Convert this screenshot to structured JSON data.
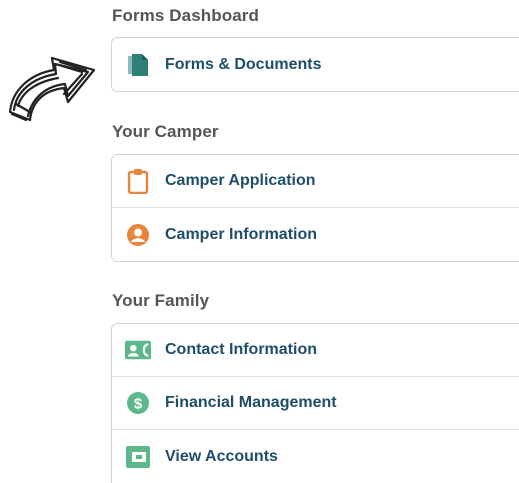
{
  "sections": [
    {
      "title": "Forms Dashboard",
      "items": [
        {
          "label": "Forms & Documents",
          "icon": "document-icon"
        }
      ]
    },
    {
      "title": "Your Camper",
      "items": [
        {
          "label": "Camper Application",
          "icon": "clipboard-icon"
        },
        {
          "label": "Camper Information",
          "icon": "user-circle-icon"
        }
      ]
    },
    {
      "title": "Your Family",
      "items": [
        {
          "label": "Contact Information",
          "icon": "contact-card-icon"
        },
        {
          "label": "Financial Management",
          "icon": "dollar-circle-icon"
        },
        {
          "label": "View Accounts",
          "icon": "wallet-icon"
        }
      ]
    }
  ],
  "colors": {
    "label": "#1f4e6b",
    "section_title": "#555555",
    "teal_icon": "#2e7f78",
    "orange_icon": "#e8833a",
    "green_icon": "#5cb88a"
  }
}
